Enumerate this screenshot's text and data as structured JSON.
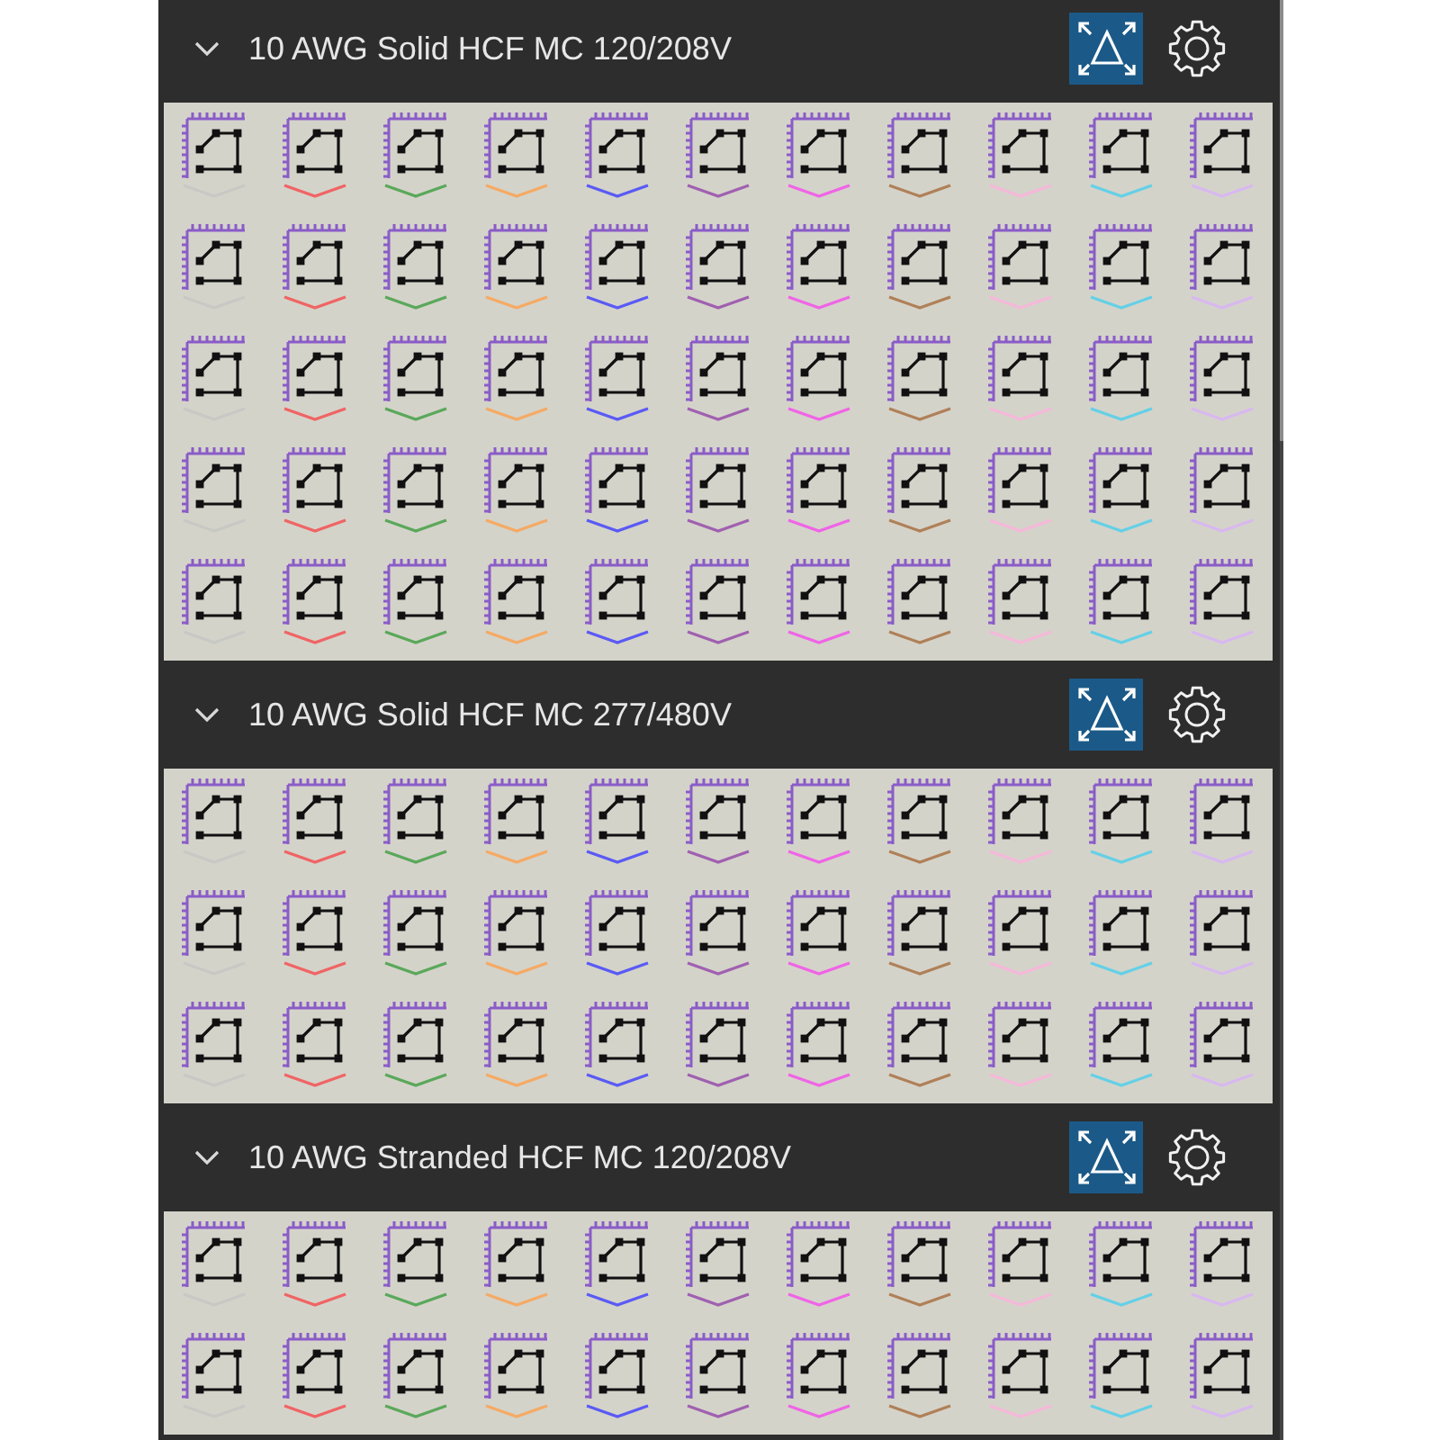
{
  "sections": [
    {
      "title": "10 AWG Solid HCF MC 120/208V",
      "expanded": true,
      "rows": [
        {
          "tiles": [
            {
              "color": "#c8c8c4"
            },
            {
              "color": "#f06464"
            },
            {
              "color": "#5aa85a"
            },
            {
              "color": "#f5aa64"
            },
            {
              "color": "#5a5af5"
            },
            {
              "color": "#a060b0"
            },
            {
              "color": "#f064e6"
            },
            {
              "color": "#b08058"
            },
            {
              "color": "#f5b8d8"
            },
            {
              "color": "#64d0e6"
            },
            {
              "color": "#d8b8f0"
            }
          ]
        },
        {
          "tiles": [
            {
              "color": "#c8c8c4"
            },
            {
              "color": "#f06464"
            },
            {
              "color": "#5aa85a"
            },
            {
              "color": "#f5aa64"
            },
            {
              "color": "#5a5af5"
            },
            {
              "color": "#a060b0"
            },
            {
              "color": "#f064e6"
            },
            {
              "color": "#b08058"
            },
            {
              "color": "#f5b8d8"
            },
            {
              "color": "#64d0e6"
            },
            {
              "color": "#d8b8f0"
            }
          ]
        },
        {
          "tiles": [
            {
              "color": "#c8c8c4"
            },
            {
              "color": "#f06464"
            },
            {
              "color": "#5aa85a"
            },
            {
              "color": "#f5aa64"
            },
            {
              "color": "#5a5af5"
            },
            {
              "color": "#a060b0"
            },
            {
              "color": "#f064e6"
            },
            {
              "color": "#b08058"
            },
            {
              "color": "#f5b8d8"
            },
            {
              "color": "#64d0e6"
            },
            {
              "color": "#d8b8f0"
            }
          ]
        },
        {
          "tiles": [
            {
              "color": "#c8c8c4"
            },
            {
              "color": "#f06464"
            },
            {
              "color": "#5aa85a"
            },
            {
              "color": "#f5aa64"
            },
            {
              "color": "#5a5af5"
            },
            {
              "color": "#a060b0"
            },
            {
              "color": "#f064e6"
            },
            {
              "color": "#b08058"
            },
            {
              "color": "#f5b8d8"
            },
            {
              "color": "#64d0e6"
            },
            {
              "color": "#d8b8f0"
            }
          ]
        },
        {
          "tiles": [
            {
              "color": "#c8c8c4"
            },
            {
              "color": "#f06464"
            },
            {
              "color": "#5aa85a"
            },
            {
              "color": "#f5aa64"
            },
            {
              "color": "#5a5af5"
            },
            {
              "color": "#a060b0"
            },
            {
              "color": "#f064e6"
            },
            {
              "color": "#b08058"
            },
            {
              "color": "#f5b8d8"
            },
            {
              "color": "#64d0e6"
            },
            {
              "color": "#d8b8f0"
            }
          ]
        }
      ]
    },
    {
      "title": "10 AWG Solid HCF MC 277/480V",
      "expanded": true,
      "rows": [
        {
          "tiles": [
            {
              "color": "#c8c8c4"
            },
            {
              "color": "#f06464"
            },
            {
              "color": "#5aa85a"
            },
            {
              "color": "#f5aa64"
            },
            {
              "color": "#5a5af5"
            },
            {
              "color": "#a060b0"
            },
            {
              "color": "#f064e6"
            },
            {
              "color": "#b08058"
            },
            {
              "color": "#f5b8d8"
            },
            {
              "color": "#64d0e6"
            },
            {
              "color": "#d8b8f0"
            }
          ]
        },
        {
          "tiles": [
            {
              "color": "#c8c8c4"
            },
            {
              "color": "#f06464"
            },
            {
              "color": "#5aa85a"
            },
            {
              "color": "#f5aa64"
            },
            {
              "color": "#5a5af5"
            },
            {
              "color": "#a060b0"
            },
            {
              "color": "#f064e6"
            },
            {
              "color": "#b08058"
            },
            {
              "color": "#f5b8d8"
            },
            {
              "color": "#64d0e6"
            },
            {
              "color": "#d8b8f0"
            }
          ]
        },
        {
          "tiles": [
            {
              "color": "#c8c8c4"
            },
            {
              "color": "#f06464"
            },
            {
              "color": "#5aa85a"
            },
            {
              "color": "#f5aa64"
            },
            {
              "color": "#5a5af5"
            },
            {
              "color": "#a060b0"
            },
            {
              "color": "#f064e6"
            },
            {
              "color": "#b08058"
            },
            {
              "color": "#f5b8d8"
            },
            {
              "color": "#64d0e6"
            },
            {
              "color": "#d8b8f0"
            }
          ]
        }
      ]
    },
    {
      "title": "10 AWG Stranded HCF MC 120/208V",
      "expanded": true,
      "rows": [
        {
          "tiles": [
            {
              "color": "#c8c8c4"
            },
            {
              "color": "#f06464"
            },
            {
              "color": "#5aa85a"
            },
            {
              "color": "#f5aa64"
            },
            {
              "color": "#5a5af5"
            },
            {
              "color": "#a060b0"
            },
            {
              "color": "#f064e6"
            },
            {
              "color": "#b08058"
            },
            {
              "color": "#f5b8d8"
            },
            {
              "color": "#64d0e6"
            },
            {
              "color": "#d8b8f0"
            }
          ]
        },
        {
          "tiles": [
            {
              "color": "#c8c8c4"
            },
            {
              "color": "#f06464"
            },
            {
              "color": "#5aa85a"
            },
            {
              "color": "#f5aa64"
            },
            {
              "color": "#5a5af5"
            },
            {
              "color": "#a060b0"
            },
            {
              "color": "#f064e6"
            },
            {
              "color": "#b08058"
            },
            {
              "color": "#f5b8d8"
            },
            {
              "color": "#64d0e6"
            },
            {
              "color": "#d8b8f0"
            }
          ]
        }
      ]
    }
  ]
}
